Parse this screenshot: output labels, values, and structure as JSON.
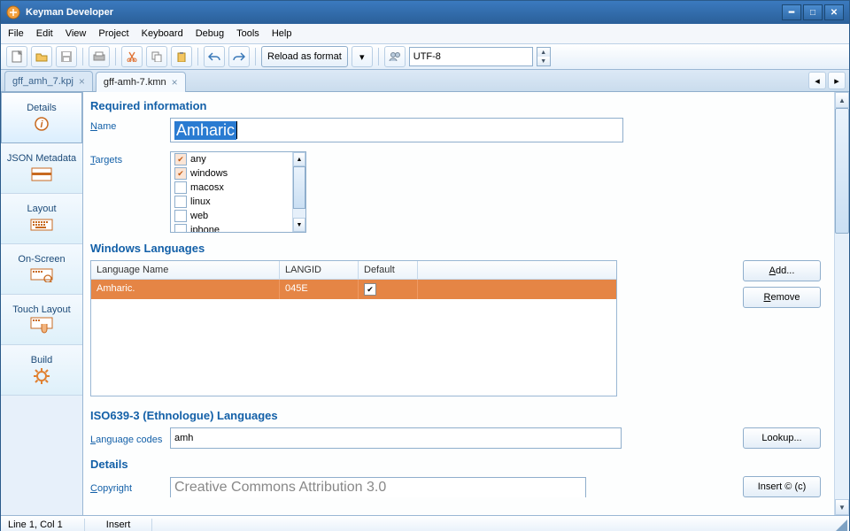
{
  "title": "Keyman Developer",
  "menu": [
    "File",
    "Edit",
    "View",
    "Project",
    "Keyboard",
    "Debug",
    "Tools",
    "Help"
  ],
  "toolbar": {
    "reload_label": "Reload as format",
    "encoding": "UTF-8"
  },
  "tabs": [
    {
      "label": "gff_amh_7.kpj",
      "active": false
    },
    {
      "label": "gff-amh-7.kmn",
      "active": true
    }
  ],
  "sidetabs": [
    "Details",
    "JSON Metadata",
    "Layout",
    "On-Screen",
    "Touch Layout",
    "Build"
  ],
  "section_required": "Required information",
  "name_label": "Name",
  "name_value": "Amharic",
  "targets_label": "Targets",
  "targets": [
    {
      "label": "any",
      "checked": true
    },
    {
      "label": "windows",
      "checked": true
    },
    {
      "label": "macosx",
      "checked": false
    },
    {
      "label": "linux",
      "checked": false
    },
    {
      "label": "web",
      "checked": false
    },
    {
      "label": "iphone",
      "checked": false
    }
  ],
  "section_winlang": "Windows Languages",
  "lang_headers": {
    "name": "Language Name",
    "id": "LANGID",
    "def": "Default"
  },
  "lang_rows": [
    {
      "name": "Amharic.",
      "id": "045E",
      "def": true
    }
  ],
  "btn_add": "Add...",
  "btn_remove": "Remove",
  "section_iso": "ISO639-3 (Ethnologue) Languages",
  "langcodes_label": "Language codes",
  "langcodes_value": "amh",
  "btn_lookup": "Lookup...",
  "section_details": "Details",
  "copyright_label": "Copyright",
  "copyright_value": "Creative Commons Attribution 3.0",
  "btn_insertc": "Insert © (c)",
  "status": {
    "pos": "Line 1, Col 1",
    "mode": "Insert"
  }
}
